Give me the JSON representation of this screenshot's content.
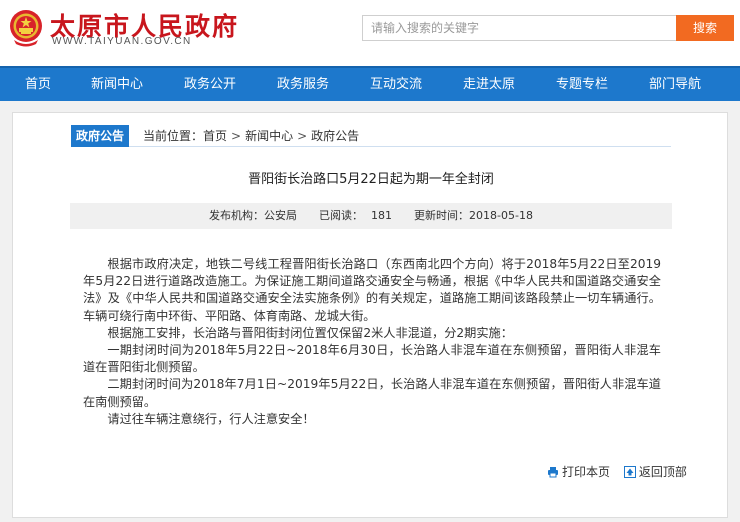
{
  "header": {
    "site_name": "太原市人民政府",
    "site_url": "WWW.TAIYUAN.GOV.CN",
    "search_placeholder": "请输入搜索的关键字",
    "search_button": "搜索"
  },
  "nav": {
    "items": [
      "首页",
      "新闻中心",
      "政务公开",
      "政务服务",
      "互动交流",
      "走进太原",
      "专题专栏",
      "部门导航"
    ]
  },
  "breadcrumb": {
    "tag": "政府公告",
    "prefix": "当前位置：",
    "items": [
      "首页",
      "新闻中心",
      "政府公告"
    ],
    "separator": ">"
  },
  "article": {
    "title": "晋阳街长治路口5月22日起为期一年全封闭",
    "meta": {
      "publisher_label": "发布机构：",
      "publisher": "公安局",
      "views_label": "已阅读：",
      "views": "181",
      "updated_label": "更新时间：",
      "updated": "2018-05-18"
    },
    "paragraphs": [
      "根据市政府决定，地铁二号线工程晋阳街长治路口（东西南北四个方向）将于2018年5月22日至2019年5月22日进行道路改造施工。为保证施工期间道路交通安全与畅通，根据《中华人民共和国道路交通安全法》及《中华人民共和国道路交通安全法实施条例》的有关规定，道路施工期间该路段禁止一切车辆通行。车辆可绕行南中环街、平阳路、体育南路、龙城大街。",
      "根据施工安排，长治路与晋阳街封闭位置仅保留2米人非混道，分2期实施：",
      "一期封闭时间为2018年5月22日~2018年6月30日，长治路人非混车道在东侧预留，晋阳街人非混车道在晋阳街北侧预留。",
      "二期封闭时间为2018年7月1日~2019年5月22日，长治路人非混车道在东侧预留，晋阳街人非混车道在南侧预留。",
      "请过往车辆注意绕行，行人注意安全！"
    ]
  },
  "footer": {
    "print_label": "打印本页",
    "print_icon": "printer-icon",
    "top_label": "返回顶部",
    "top_icon": "back-to-top-icon"
  },
  "colors": {
    "brand_red": "#c8161d",
    "nav_blue": "#1d78cc",
    "search_orange": "#f26a21"
  }
}
